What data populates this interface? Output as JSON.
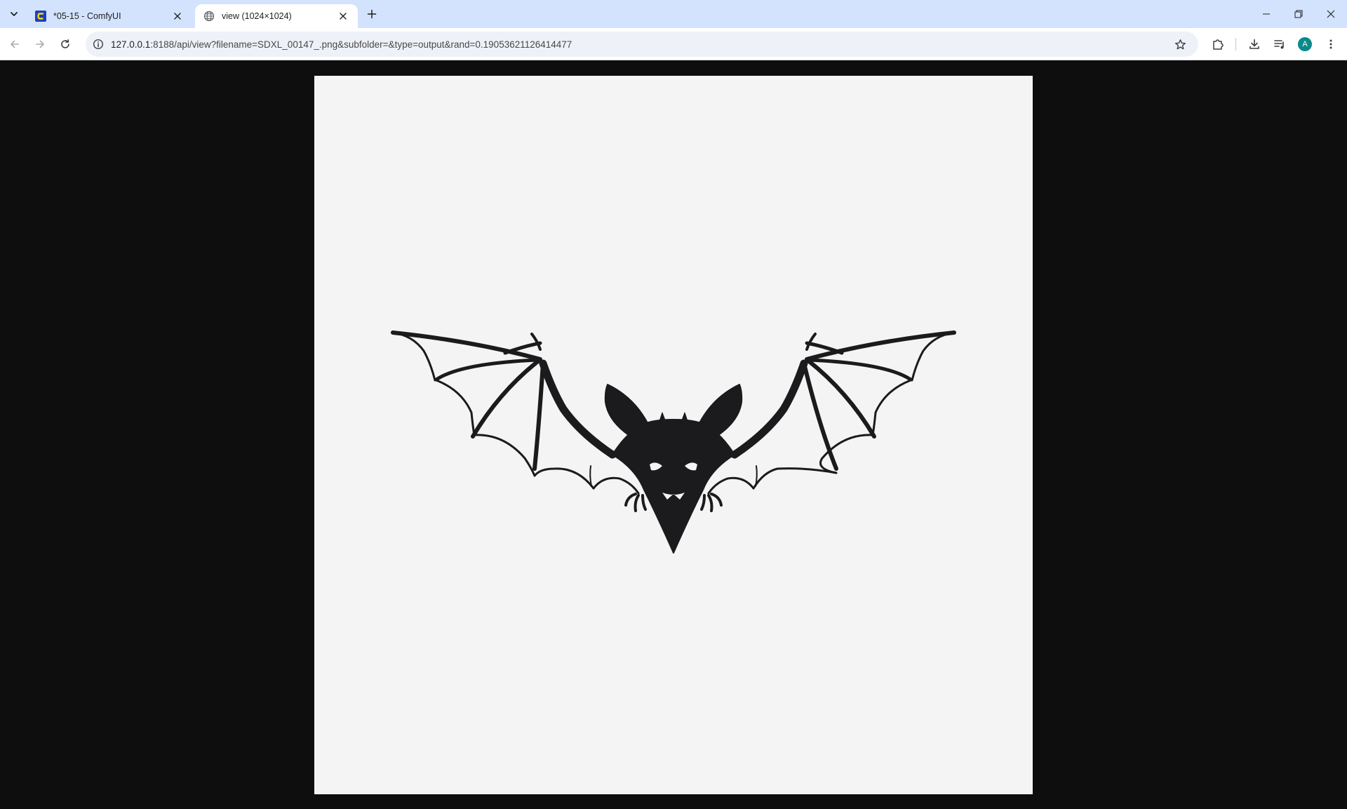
{
  "browser": {
    "tabs": [
      {
        "title": "*05-15 - ComfyUI",
        "favicon": "comfyui-logo-icon",
        "active": false
      },
      {
        "title": "view (1024×1024)",
        "favicon": "globe-icon",
        "active": true
      }
    ],
    "new_tab_icon": "plus-icon",
    "tab_search_icon": "chevron-down-icon",
    "window_controls": [
      "minimize-icon",
      "restore-icon",
      "close-icon"
    ]
  },
  "toolbar": {
    "url_host": "127.0.0.1",
    "url_rest": ":8188/api/view?filename=SDXL_00147_.png&subfolder=&type=output&rand=0.19053621126414477",
    "profile_initial": "A",
    "profile_color": "#0b8a8a"
  },
  "image": {
    "subject": "bat-silhouette",
    "background_color": "#f4f4f4",
    "ink_color": "#1b1b1d"
  },
  "colors": {
    "tabstrip": "#d3e3fd",
    "page_background": "#0e0e0e",
    "omnibox": "#eef2f8"
  }
}
